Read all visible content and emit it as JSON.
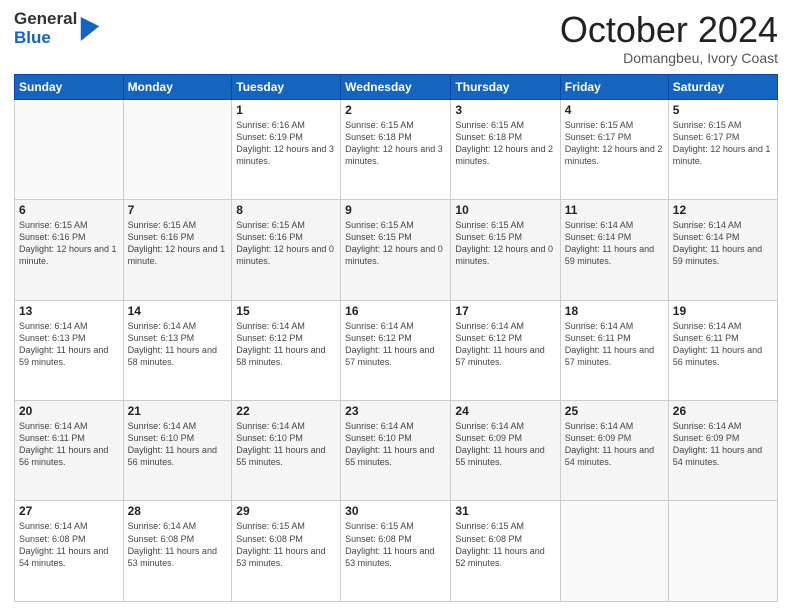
{
  "logo": {
    "general": "General",
    "blue": "Blue"
  },
  "header": {
    "month": "October 2024",
    "location": "Domangbeu, Ivory Coast"
  },
  "days_of_week": [
    "Sunday",
    "Monday",
    "Tuesday",
    "Wednesday",
    "Thursday",
    "Friday",
    "Saturday"
  ],
  "weeks": [
    [
      {
        "day": "",
        "info": ""
      },
      {
        "day": "",
        "info": ""
      },
      {
        "day": "1",
        "info": "Sunrise: 6:16 AM\nSunset: 6:19 PM\nDaylight: 12 hours and 3 minutes."
      },
      {
        "day": "2",
        "info": "Sunrise: 6:15 AM\nSunset: 6:18 PM\nDaylight: 12 hours and 3 minutes."
      },
      {
        "day": "3",
        "info": "Sunrise: 6:15 AM\nSunset: 6:18 PM\nDaylight: 12 hours and 2 minutes."
      },
      {
        "day": "4",
        "info": "Sunrise: 6:15 AM\nSunset: 6:17 PM\nDaylight: 12 hours and 2 minutes."
      },
      {
        "day": "5",
        "info": "Sunrise: 6:15 AM\nSunset: 6:17 PM\nDaylight: 12 hours and 1 minute."
      }
    ],
    [
      {
        "day": "6",
        "info": "Sunrise: 6:15 AM\nSunset: 6:16 PM\nDaylight: 12 hours and 1 minute."
      },
      {
        "day": "7",
        "info": "Sunrise: 6:15 AM\nSunset: 6:16 PM\nDaylight: 12 hours and 1 minute."
      },
      {
        "day": "8",
        "info": "Sunrise: 6:15 AM\nSunset: 6:16 PM\nDaylight: 12 hours and 0 minutes."
      },
      {
        "day": "9",
        "info": "Sunrise: 6:15 AM\nSunset: 6:15 PM\nDaylight: 12 hours and 0 minutes."
      },
      {
        "day": "10",
        "info": "Sunrise: 6:15 AM\nSunset: 6:15 PM\nDaylight: 12 hours and 0 minutes."
      },
      {
        "day": "11",
        "info": "Sunrise: 6:14 AM\nSunset: 6:14 PM\nDaylight: 11 hours and 59 minutes."
      },
      {
        "day": "12",
        "info": "Sunrise: 6:14 AM\nSunset: 6:14 PM\nDaylight: 11 hours and 59 minutes."
      }
    ],
    [
      {
        "day": "13",
        "info": "Sunrise: 6:14 AM\nSunset: 6:13 PM\nDaylight: 11 hours and 59 minutes."
      },
      {
        "day": "14",
        "info": "Sunrise: 6:14 AM\nSunset: 6:13 PM\nDaylight: 11 hours and 58 minutes."
      },
      {
        "day": "15",
        "info": "Sunrise: 6:14 AM\nSunset: 6:12 PM\nDaylight: 11 hours and 58 minutes."
      },
      {
        "day": "16",
        "info": "Sunrise: 6:14 AM\nSunset: 6:12 PM\nDaylight: 11 hours and 57 minutes."
      },
      {
        "day": "17",
        "info": "Sunrise: 6:14 AM\nSunset: 6:12 PM\nDaylight: 11 hours and 57 minutes."
      },
      {
        "day": "18",
        "info": "Sunrise: 6:14 AM\nSunset: 6:11 PM\nDaylight: 11 hours and 57 minutes."
      },
      {
        "day": "19",
        "info": "Sunrise: 6:14 AM\nSunset: 6:11 PM\nDaylight: 11 hours and 56 minutes."
      }
    ],
    [
      {
        "day": "20",
        "info": "Sunrise: 6:14 AM\nSunset: 6:11 PM\nDaylight: 11 hours and 56 minutes."
      },
      {
        "day": "21",
        "info": "Sunrise: 6:14 AM\nSunset: 6:10 PM\nDaylight: 11 hours and 56 minutes."
      },
      {
        "day": "22",
        "info": "Sunrise: 6:14 AM\nSunset: 6:10 PM\nDaylight: 11 hours and 55 minutes."
      },
      {
        "day": "23",
        "info": "Sunrise: 6:14 AM\nSunset: 6:10 PM\nDaylight: 11 hours and 55 minutes."
      },
      {
        "day": "24",
        "info": "Sunrise: 6:14 AM\nSunset: 6:09 PM\nDaylight: 11 hours and 55 minutes."
      },
      {
        "day": "25",
        "info": "Sunrise: 6:14 AM\nSunset: 6:09 PM\nDaylight: 11 hours and 54 minutes."
      },
      {
        "day": "26",
        "info": "Sunrise: 6:14 AM\nSunset: 6:09 PM\nDaylight: 11 hours and 54 minutes."
      }
    ],
    [
      {
        "day": "27",
        "info": "Sunrise: 6:14 AM\nSunset: 6:08 PM\nDaylight: 11 hours and 54 minutes."
      },
      {
        "day": "28",
        "info": "Sunrise: 6:14 AM\nSunset: 6:08 PM\nDaylight: 11 hours and 53 minutes."
      },
      {
        "day": "29",
        "info": "Sunrise: 6:15 AM\nSunset: 6:08 PM\nDaylight: 11 hours and 53 minutes."
      },
      {
        "day": "30",
        "info": "Sunrise: 6:15 AM\nSunset: 6:08 PM\nDaylight: 11 hours and 53 minutes."
      },
      {
        "day": "31",
        "info": "Sunrise: 6:15 AM\nSunset: 6:08 PM\nDaylight: 11 hours and 52 minutes."
      },
      {
        "day": "",
        "info": ""
      },
      {
        "day": "",
        "info": ""
      }
    ]
  ]
}
